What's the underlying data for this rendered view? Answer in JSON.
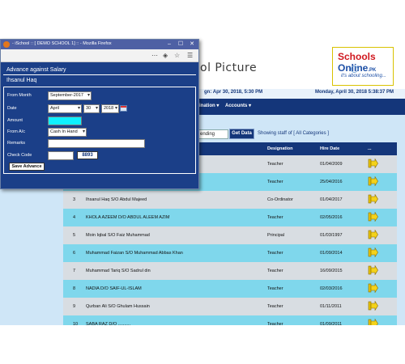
{
  "window": {
    "title": "- iSchool :: [ DEMO SCHOOL 1] :: - Mozilla Firefox"
  },
  "banner": {
    "picture_text": "ol Picture",
    "logo_schools": "Schools",
    "logo_online": "Online",
    "logo_suffix": ".PK",
    "logo_tagline": "it's about schooling..."
  },
  "datebar": {
    "left": "gn: Apr 30, 2018, 5:30 PM",
    "right": "Monday, April 30, 2018 5:38:37 PM"
  },
  "menu": {
    "items": [
      "ination ▾",
      "Accounts ▾"
    ]
  },
  "filters": {
    "sort_value": "ending",
    "get_data": "Get Data",
    "showing": "Showing staff of [ All Categories ]"
  },
  "table": {
    "headers": [
      "Designation",
      "Hire Date",
      "..."
    ],
    "rows": [
      {
        "num": "",
        "name": "",
        "designation": "Teacher",
        "date": "01/04/2009",
        "style": "plain"
      },
      {
        "num": "",
        "name": "",
        "designation": "Teacher",
        "date": "25/04/2016",
        "style": "alt"
      },
      {
        "num": "3",
        "name": "Ihsanul Haq S/O Abdul Majeed",
        "designation": "Co-Ordinator",
        "date": "01/04/2017",
        "style": "plain"
      },
      {
        "num": "4",
        "name": "KHOLA AZEEM D/O ABDUL ALEEM AZIM",
        "designation": "Teacher",
        "date": "02/05/2016",
        "style": "alt"
      },
      {
        "num": "5",
        "name": "Moin Iqbal S/O Faiz Muhammad",
        "designation": "Principal",
        "date": "01/03/1997",
        "style": "plain"
      },
      {
        "num": "6",
        "name": "Muhammad Faizan S/O Muhammad Abbas Khan",
        "designation": "Teacher",
        "date": "01/09/2014",
        "style": "alt"
      },
      {
        "num": "7",
        "name": "Muhammad Tariq S/O Sadrul din",
        "designation": "Teacher",
        "date": "16/09/2015",
        "style": "plain"
      },
      {
        "num": "8",
        "name": "NADIA D/O SAIF-UL-ISLAM",
        "designation": "Teacher",
        "date": "02/03/2016",
        "style": "alt"
      },
      {
        "num": "9",
        "name": "Qurban Ali S/O Ghulam Hussain",
        "designation": "Teacher",
        "date": "01/11/2011",
        "style": "plain"
      },
      {
        "num": "10",
        "name": "SABA RAZ D/O ..........",
        "designation": "Teacher",
        "date": "01/09/2011",
        "style": "alt"
      }
    ]
  },
  "popup": {
    "form_title": "Advance against Salary",
    "employee": "Ihsanul Haq",
    "labels": {
      "from_month": "From Month",
      "date": "Date",
      "amount": "Amount",
      "from_ac": "From A/c",
      "remarks": "Remarks",
      "check_code": "Check Code"
    },
    "values": {
      "from_month": "September-2017",
      "date_month": "April",
      "date_day": "30",
      "date_year": "2018",
      "amount": "",
      "from_ac": "Cash In Hand",
      "remarks": "",
      "check_code": "",
      "captcha": "8893"
    },
    "save_label": "Save Advance"
  },
  "colors": {
    "navy": "#14367a",
    "row_alt": "#7fd7ec",
    "row_plain": "#d8dde2",
    "popup_bg": "#1b3f88",
    "amount_highlight": "#0ff0ff"
  }
}
